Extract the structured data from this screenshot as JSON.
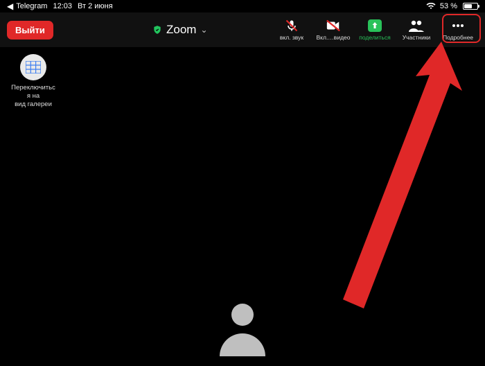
{
  "status_bar": {
    "back_app": "Telegram",
    "time": "12:03",
    "date": "Вт 2 июня",
    "battery_pct": "53 %"
  },
  "toolbar": {
    "leave_label": "Выйти",
    "title": "Zoom",
    "audio_label": "вкл. звук",
    "video_label": "Вкл.…видео",
    "share_label": "поделиться",
    "participants_label": "Участники",
    "more_label": "Подробнее"
  },
  "gallery": {
    "line1": "Переключитьс",
    "line2": "я на",
    "line3": "вид галереи"
  },
  "colors": {
    "accent_red": "#e02828",
    "accent_green": "#29c25a"
  }
}
